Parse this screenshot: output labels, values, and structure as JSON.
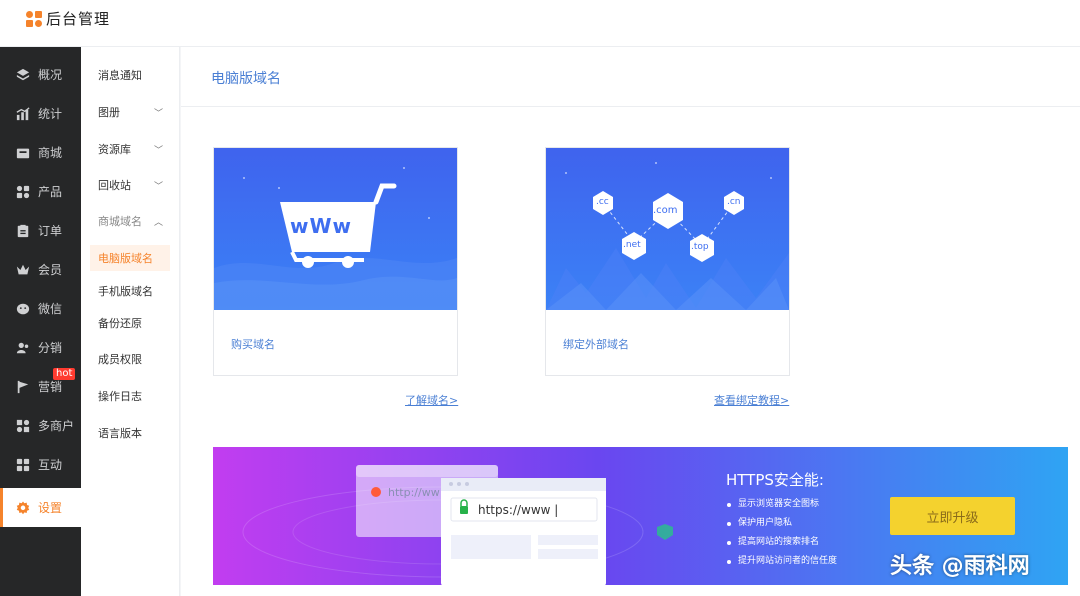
{
  "header": {
    "app_title": "后台管理"
  },
  "sidebar": {
    "items": [
      {
        "label": "概况",
        "icon": "layers-icon"
      },
      {
        "label": "统计",
        "icon": "chart-icon"
      },
      {
        "label": "商城",
        "icon": "store-icon"
      },
      {
        "label": "产品",
        "icon": "grid-icon"
      },
      {
        "label": "订单",
        "icon": "clipboard-icon"
      },
      {
        "label": "会员",
        "icon": "crown-icon"
      },
      {
        "label": "微信",
        "icon": "wechat-icon"
      },
      {
        "label": "分销",
        "icon": "users-icon"
      },
      {
        "label": "营销",
        "icon": "flag-icon"
      },
      {
        "label": "多商户",
        "icon": "shop-icon"
      },
      {
        "label": "互动",
        "icon": "apps-icon"
      },
      {
        "label": "设置",
        "icon": "gear-icon",
        "active": true
      }
    ],
    "hot_badge": "hot"
  },
  "subnav": {
    "items": [
      {
        "label": "消息通知"
      },
      {
        "label": "图册",
        "chevron": "﹀"
      },
      {
        "label": "资源库",
        "chevron": "﹀"
      },
      {
        "label": "回收站",
        "chevron": "﹀"
      },
      {
        "label": "商城域名",
        "chevron": "︿"
      },
      {
        "label": "电脑版域名",
        "active": true
      },
      {
        "label": "手机版域名"
      },
      {
        "label": "备份还原"
      },
      {
        "label": "成员权限"
      },
      {
        "label": "操作日志"
      },
      {
        "label": "语言版本"
      }
    ]
  },
  "main": {
    "title": "电脑版域名",
    "cards": [
      {
        "label": "购买域名",
        "link": "了解域名>"
      },
      {
        "label": "绑定外部域名",
        "link": "查看绑定教程>"
      }
    ],
    "domain_tags": [
      ".cc",
      ".com",
      ".cn",
      ".net",
      ".top"
    ],
    "cart_text": "wWw",
    "banner": {
      "title": "HTTPS安全能:",
      "features": [
        "显示浏览器安全图标",
        "保护用户隐私",
        "提高网站的搜索排名",
        "提升网站访问者的信任度"
      ],
      "button": "立即升级",
      "http_text": "http://ww",
      "https_text": "https://www |"
    }
  },
  "watermark": "头条 @雨科网",
  "colors": {
    "accent": "#f5832b",
    "link": "#4a7fd4",
    "sidebar_bg": "#262728",
    "button": "#f4d22e"
  }
}
